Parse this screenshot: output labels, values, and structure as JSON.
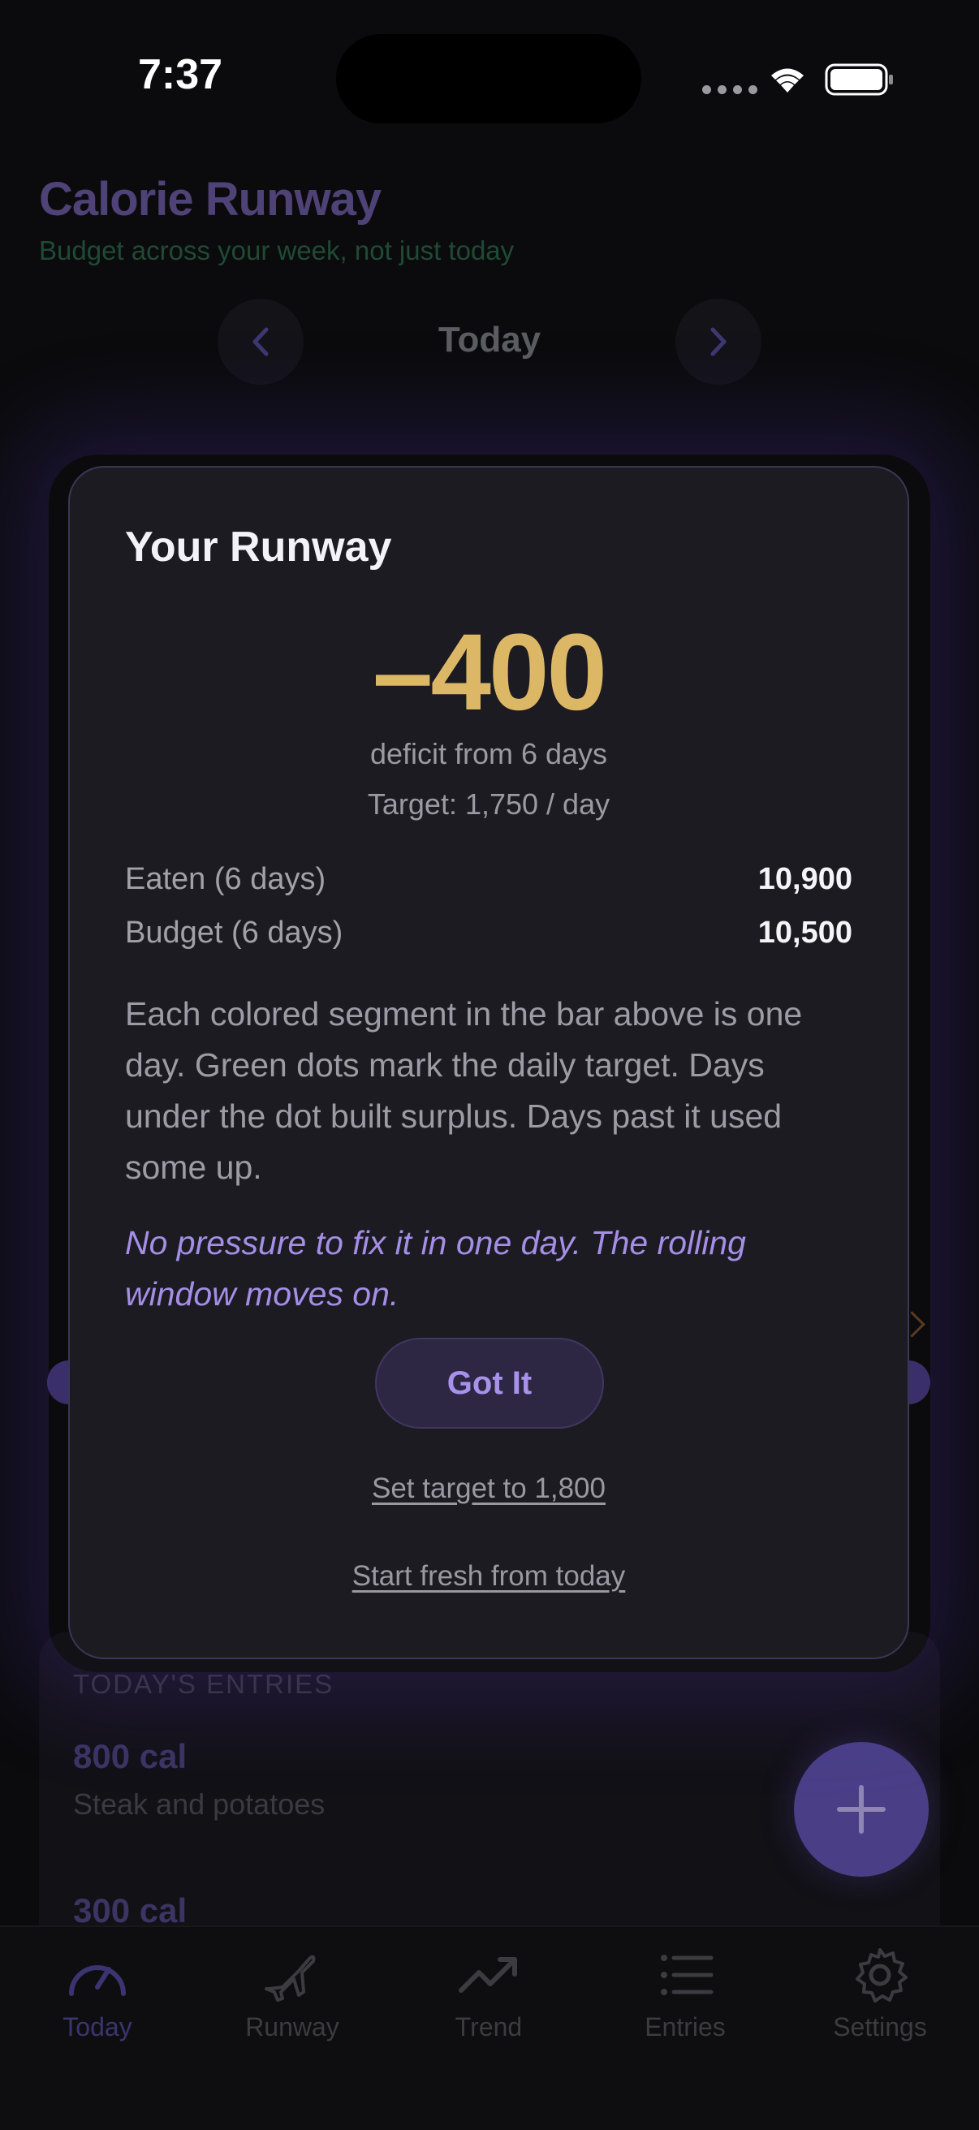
{
  "status_bar": {
    "time": "7:37"
  },
  "app": {
    "title": "Calorie Runway",
    "subtitle": "Budget across your week, not just today",
    "day_label": "Today"
  },
  "entries": {
    "heading": "TODAY'S ENTRIES",
    "items": [
      {
        "calories": "800 cal",
        "description": "Steak and potatoes"
      },
      {
        "calories": "300 cal"
      }
    ]
  },
  "modal": {
    "title": "Your Runway",
    "value": "–400",
    "caption": "deficit from 6 days",
    "target": "Target: 1,750 / day",
    "stats": [
      {
        "label": "Eaten (6 days)",
        "value": "10,900"
      },
      {
        "label": "Budget (6 days)",
        "value": "10,500"
      }
    ],
    "explanation": "Each colored segment in the bar above is one day. Green dots mark the daily target. Days under the dot built surplus. Days past it used some up.",
    "reassurance": "No pressure to fix it in one day. The rolling window moves on.",
    "primary_button": "Got It",
    "link_set_target": "Set target to 1,800",
    "link_start_fresh": "Start fresh from today"
  },
  "tabs": [
    {
      "label": "Today",
      "icon": "gauge-icon",
      "active": true
    },
    {
      "label": "Runway",
      "icon": "airplane-icon",
      "active": false
    },
    {
      "label": "Trend",
      "icon": "trend-icon",
      "active": false
    },
    {
      "label": "Entries",
      "icon": "list-icon",
      "active": false
    },
    {
      "label": "Settings",
      "icon": "gear-icon",
      "active": false
    }
  ],
  "colors": {
    "accent": "#a791ea",
    "runway_value": "#dcb866",
    "background": "#0b0b0d",
    "modal_background": "#1c1b22"
  }
}
